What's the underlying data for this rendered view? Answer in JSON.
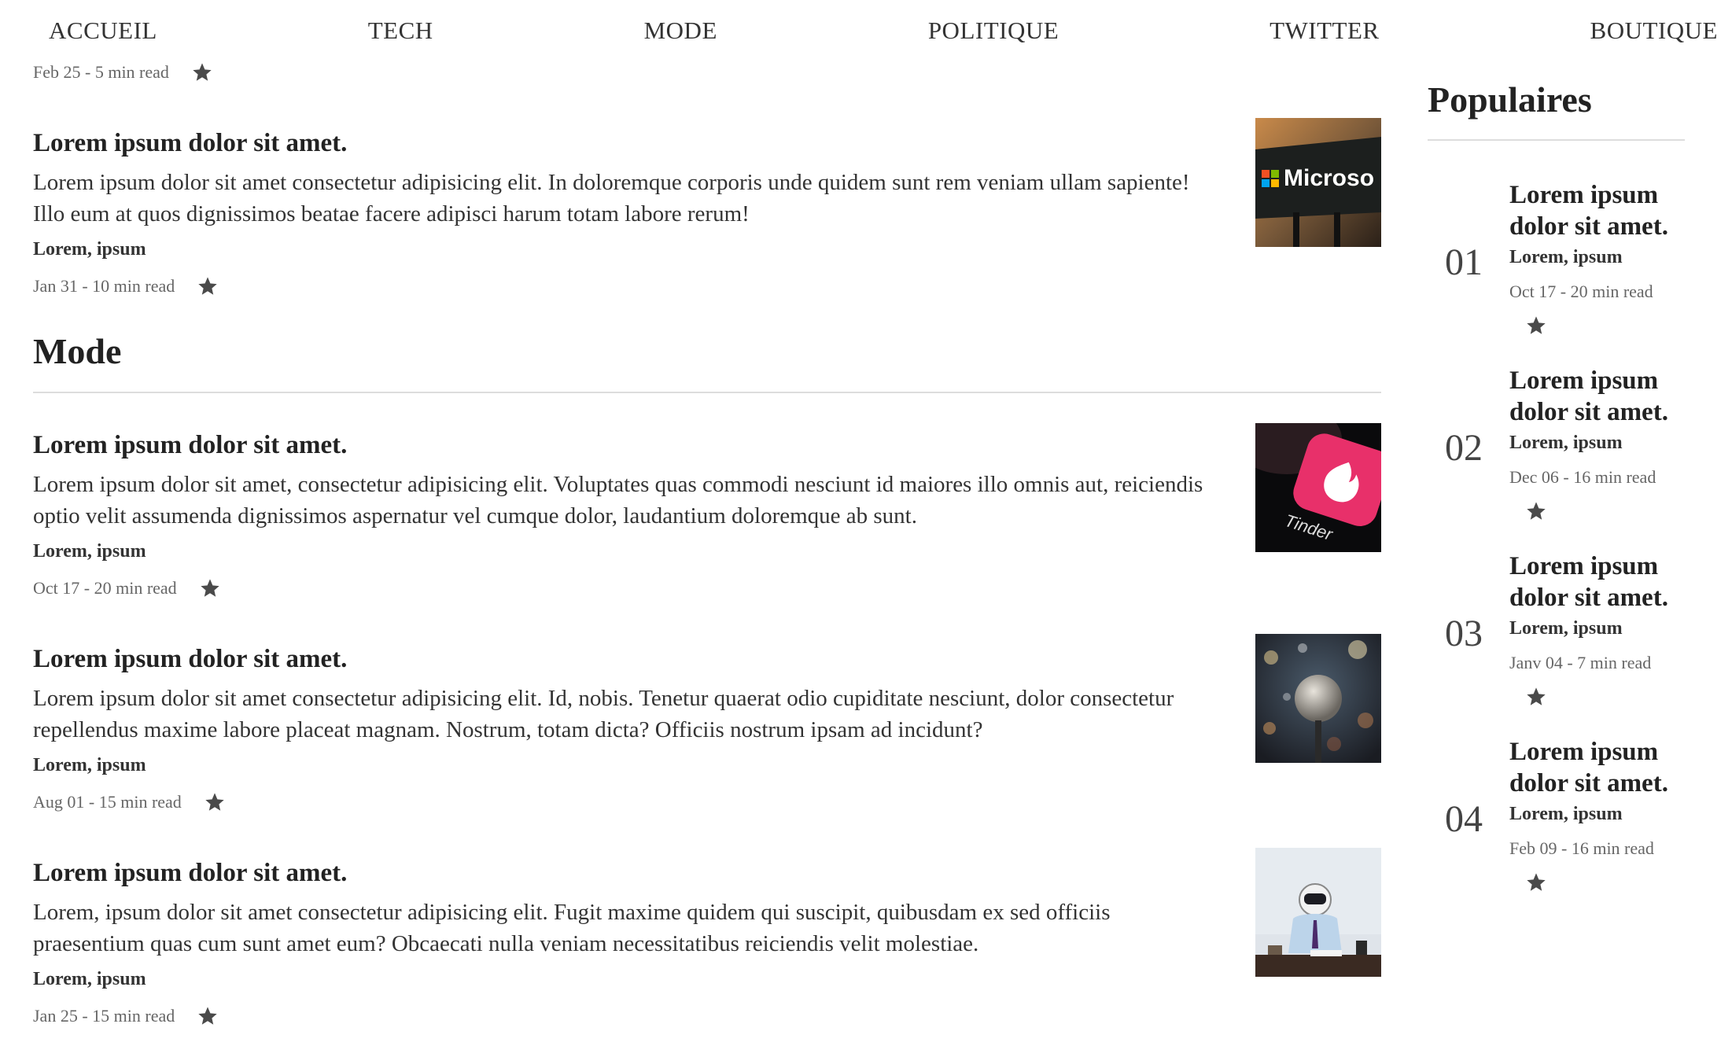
{
  "nav": {
    "items": [
      {
        "label": "ACCUEIL"
      },
      {
        "label": "TECH"
      },
      {
        "label": "MODE"
      },
      {
        "label": "POLITIQUE"
      },
      {
        "label": "TWITTER"
      },
      {
        "label": "BOUTIQUE"
      }
    ]
  },
  "main": {
    "top_meta": {
      "date": "Feb 25 - 5 min read",
      "icon": "star-icon"
    },
    "tech_articles": [
      {
        "title": "Lorem ipsum dolor sit amet.",
        "excerpt": "Lorem ipsum dolor sit amet consectetur adipisicing elit. In doloremque corporis unde quidem sunt rem veniam ullam sapiente! Illo eum at quos dignissimos beatae facere adipisci harum totam labore rerum!",
        "author": "Lorem, ipsum",
        "meta": "Jan 31 - 10 min read",
        "thumbnail": "microsoft-sign-image"
      }
    ],
    "section_title": "Mode",
    "mode_articles": [
      {
        "title": "Lorem ipsum dolor sit amet.",
        "excerpt": "Lorem ipsum dolor sit amet, consectetur adipisicing elit. Voluptates quas commodi nesciunt id maiores illo omnis aut, reiciendis optio velit assumenda dignissimos aspernatur vel cumque dolor, laudantium doloremque ab sunt.",
        "author": "Lorem, ipsum",
        "meta": "Oct 17 - 20 min read",
        "thumbnail": "tinder-app-image"
      },
      {
        "title": "Lorem ipsum dolor sit amet.",
        "excerpt": "Lorem ipsum dolor sit amet consectetur adipisicing elit. Id, nobis. Tenetur quaerat odio cupiditate nesciunt, dolor consectetur repellendus maxime labore placeat magnam. Nostrum, totam dicta? Officiis nostrum ipsam ad incidunt?",
        "author": "Lorem, ipsum",
        "meta": "Aug 01 - 15 min read",
        "thumbnail": "microphone-bokeh-image"
      },
      {
        "title": "Lorem ipsum dolor sit amet.",
        "excerpt": "Lorem, ipsum dolor sit amet consectetur adipisicing elit. Fugit maxime quidem qui suscipit, quibusdam ex sed officiis praesentium quas cum sunt amet eum? Obcaecati nulla veniam necessitatibus reiciendis velit molestiae.",
        "author": "Lorem, ipsum",
        "meta": "Jan 25 - 15 min read",
        "thumbnail": "astronaut-desk-image"
      }
    ]
  },
  "sidebar": {
    "heading": "Populaires",
    "items": [
      {
        "num": "01",
        "title": "Lorem ipsum dolor sit amet.",
        "author": "Lorem, ipsum",
        "meta": "Oct 17 - 20 min read"
      },
      {
        "num": "02",
        "title": "Lorem ipsum dolor sit amet.",
        "author": "Lorem, ipsum",
        "meta": "Dec 06 - 16 min read"
      },
      {
        "num": "03",
        "title": "Lorem ipsum dolor sit amet.",
        "author": "Lorem, ipsum",
        "meta": "Janv 04 - 7 min read"
      },
      {
        "num": "04",
        "title": "Lorem ipsum dolor sit amet.",
        "author": "Lorem, ipsum",
        "meta": "Feb 09 - 16 min read"
      }
    ]
  },
  "colors": {
    "text": "#222222",
    "muted": "#666666",
    "rule": "#dddddd",
    "star": "#4a4a4a"
  }
}
